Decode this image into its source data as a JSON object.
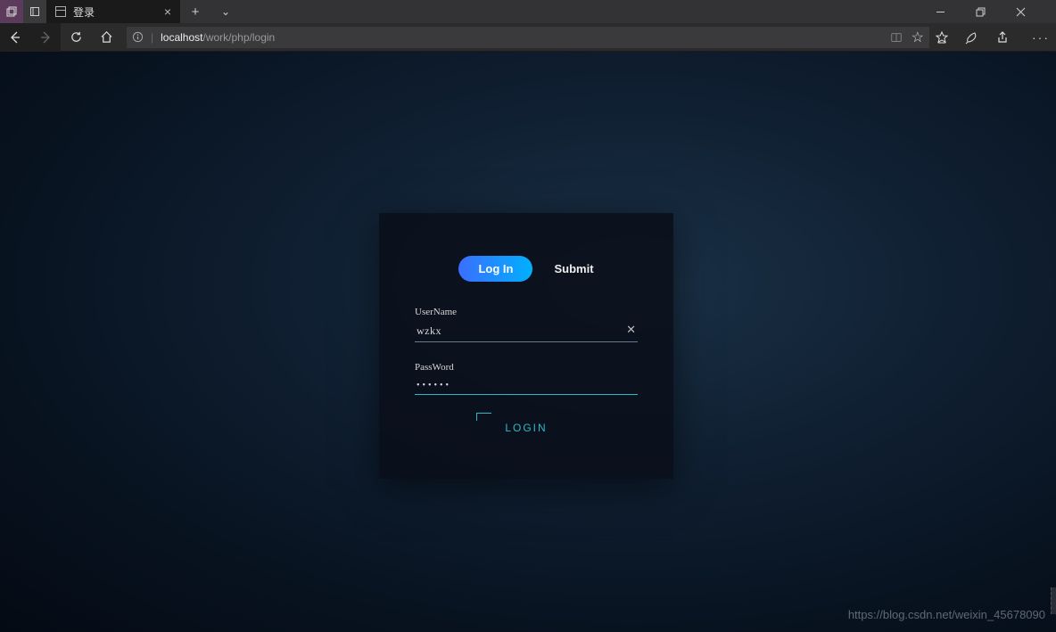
{
  "browser": {
    "tab_title": "登录",
    "url_host": "localhost",
    "url_path": "/work/php/login"
  },
  "form": {
    "login_tab": "Log In",
    "submit_tab": "Submit",
    "username_label": "UserName",
    "username_value": "wzkx",
    "password_label": "PassWord",
    "password_value": "••••••",
    "login_button": "LOGIN"
  },
  "watermark": "https://blog.csdn.net/weixin_45678090"
}
